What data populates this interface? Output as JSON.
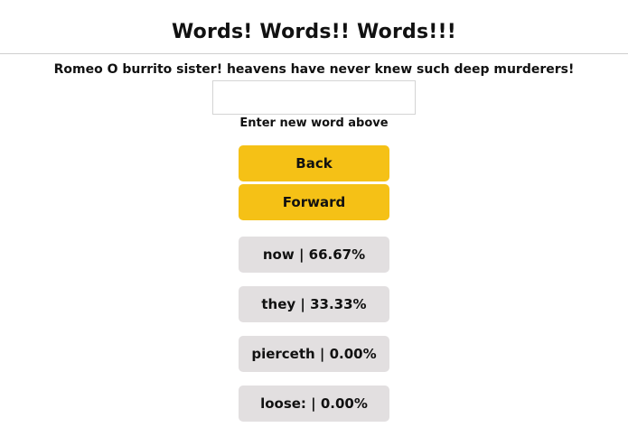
{
  "header": {
    "title": "Words! Words!! Words!!!"
  },
  "sentence": "Romeo O burrito sister! heavens have never knew such deep murderers!",
  "input": {
    "value": "",
    "hint": "Enter new word above"
  },
  "nav": {
    "back_label": "Back",
    "forward_label": "Forward"
  },
  "suggestions": [
    {
      "label": "now | 66.67%"
    },
    {
      "label": "they | 33.33%"
    },
    {
      "label": "pierceth | 0.00%"
    },
    {
      "label": "loose: | 0.00%"
    }
  ],
  "colors": {
    "nav_button": "#f5c116",
    "suggestion_button": "#e2dfe0"
  }
}
